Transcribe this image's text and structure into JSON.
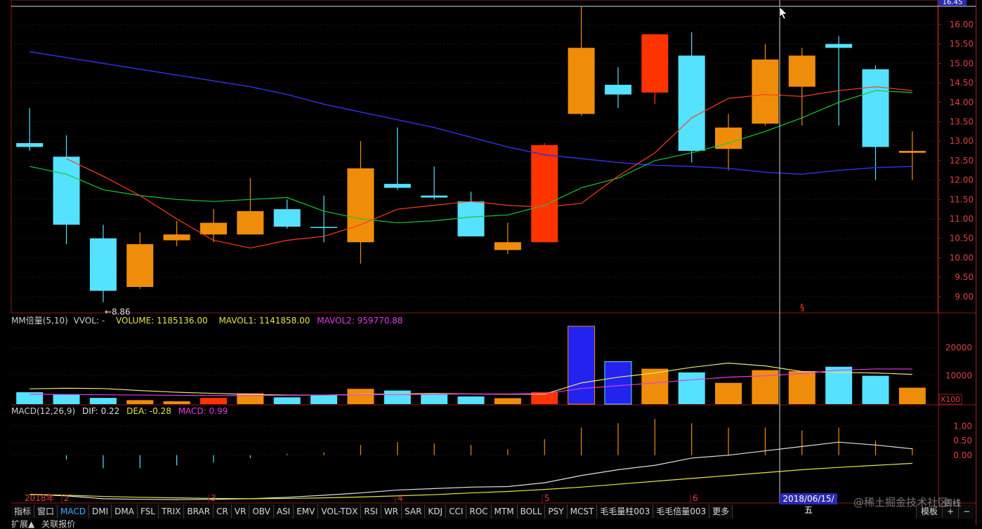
{
  "colors": {
    "up": "#ff3300",
    "up_hollow": "#ef8d0a",
    "down": "#54e2ff",
    "axis": "#8b1a1a",
    "grid": "#5a0f0f",
    "ma5": "#ff3b1f",
    "ma10": "#16c936",
    "ma60": "#2f2fe0",
    "vol_ma1": "#e6e66b",
    "vol_ma2": "#e33ae3",
    "dif": "#e0e0e0",
    "dea": "#e6e640",
    "blue_bar": "#2323f0"
  },
  "header": {
    "price_badge": "16.45",
    "low_marker": "8.86",
    "cursor_date": "2018/06/15/五",
    "flag": "§"
  },
  "volume_panel": {
    "indicator": "MM倍量(5,10)",
    "vvol": "VVOL: -",
    "volume": "VOLUME: 1185136.00",
    "mavol1": "MAVOL1: 1141858.00",
    "mavol2": "MAVOL2: 959770.88",
    "unit": "X100"
  },
  "macd_panel": {
    "indicator": "MACD(12,26,9)",
    "dif": "DIF: 0.22",
    "dea": "DEA: -0.28",
    "macd": "MACD: 0.99"
  },
  "x_axis": {
    "year": "2018年",
    "months": [
      "2",
      "3",
      "4",
      "5",
      "6"
    ]
  },
  "tabs": [
    "指标",
    "窗口",
    "MACD",
    "DMI",
    "DMA",
    "FSL",
    "TRIX",
    "BRAR",
    "CR",
    "VR",
    "OBV",
    "ASI",
    "EMV",
    "VOL-TDX",
    "RSI",
    "WR",
    "SAR",
    "KDJ",
    "CCI",
    "ROC",
    "MTM",
    "BOLL",
    "PSY",
    "MCST",
    "毛毛量柱003",
    "毛毛倍量003",
    "更多"
  ],
  "active_tab": "MACD",
  "right_buttons": [
    "模板",
    "+",
    "−"
  ],
  "bottom_bar": [
    "扩展▲",
    "关联报价"
  ],
  "watermark": "@稀土掘金技术社区",
  "watermark_tail": "周线",
  "chart_data": [
    {
      "type": "candlestick",
      "period": "weekly",
      "y_axis_ticks": [
        "16.00",
        "15.50",
        "15.00",
        "14.50",
        "14.00",
        "13.50",
        "13.00",
        "12.50",
        "12.00",
        "11.50",
        "11.00",
        "10.50",
        "10.00",
        "9.50",
        "9.00"
      ],
      "ylim": [
        8.6,
        16.45
      ],
      "candles": [
        {
          "open": 12.95,
          "high": 13.85,
          "low": 12.75,
          "close": 12.85,
          "dir": "down"
        },
        {
          "open": 12.6,
          "high": 13.15,
          "low": 10.35,
          "close": 10.85,
          "dir": "down"
        },
        {
          "open": 10.5,
          "high": 10.85,
          "low": 8.86,
          "close": 9.15,
          "dir": "down"
        },
        {
          "open": 9.25,
          "high": 10.65,
          "low": 9.2,
          "close": 10.35,
          "dir": "up"
        },
        {
          "open": 10.45,
          "high": 10.95,
          "low": 10.3,
          "close": 10.6,
          "dir": "up"
        },
        {
          "open": 10.6,
          "high": 11.25,
          "low": 10.4,
          "close": 10.9,
          "dir": "up"
        },
        {
          "open": 10.6,
          "high": 12.05,
          "low": 10.6,
          "close": 11.2,
          "dir": "up"
        },
        {
          "open": 11.25,
          "high": 11.5,
          "low": 10.75,
          "close": 10.8,
          "dir": "down"
        },
        {
          "open": 10.78,
          "high": 11.6,
          "low": 10.4,
          "close": 10.78,
          "dir": "doji"
        },
        {
          "open": 10.4,
          "high": 13.0,
          "low": 9.85,
          "close": 12.3,
          "dir": "up"
        },
        {
          "open": 11.9,
          "high": 13.35,
          "low": 11.75,
          "close": 11.8,
          "dir": "down"
        },
        {
          "open": 11.6,
          "high": 12.35,
          "low": 11.5,
          "close": 11.55,
          "dir": "down"
        },
        {
          "open": 11.45,
          "high": 11.7,
          "low": 10.6,
          "close": 10.55,
          "dir": "down"
        },
        {
          "open": 10.2,
          "high": 10.9,
          "low": 10.1,
          "close": 10.4,
          "dir": "up"
        },
        {
          "open": 10.4,
          "high": 12.95,
          "low": 10.4,
          "close": 12.9,
          "dir": "up_solid"
        },
        {
          "open": 13.7,
          "high": 16.45,
          "low": 13.65,
          "close": 15.4,
          "dir": "up"
        },
        {
          "open": 14.45,
          "high": 14.9,
          "low": 13.85,
          "close": 14.2,
          "dir": "down"
        },
        {
          "open": 14.25,
          "high": 15.75,
          "low": 13.95,
          "close": 15.75,
          "dir": "up_solid"
        },
        {
          "open": 15.2,
          "high": 15.8,
          "low": 12.45,
          "close": 12.75,
          "dir": "down"
        },
        {
          "open": 12.8,
          "high": 13.7,
          "low": 12.25,
          "close": 13.35,
          "dir": "up"
        },
        {
          "open": 13.45,
          "high": 15.5,
          "low": 13.4,
          "close": 15.1,
          "dir": "up"
        },
        {
          "open": 14.4,
          "high": 15.4,
          "low": 13.4,
          "close": 15.2,
          "dir": "up"
        },
        {
          "open": 15.5,
          "high": 15.7,
          "low": 13.4,
          "close": 15.4,
          "dir": "down"
        },
        {
          "open": 14.85,
          "high": 14.95,
          "low": 12.0,
          "close": 12.85,
          "dir": "down"
        },
        {
          "open": 12.7,
          "high": 13.25,
          "low": 12.0,
          "close": 12.75,
          "dir": "up"
        }
      ],
      "ma_short": [
        null,
        12.55,
        12.1,
        11.6,
        11.0,
        10.45,
        10.25,
        10.45,
        10.55,
        10.85,
        11.25,
        11.35,
        11.45,
        11.35,
        11.3,
        11.4,
        12.1,
        12.7,
        13.6,
        14.1,
        14.2,
        14.15,
        14.3,
        14.4,
        14.3
      ],
      "ma_mid": [
        12.35,
        12.15,
        11.75,
        11.6,
        11.5,
        11.45,
        11.5,
        11.55,
        11.2,
        11.0,
        10.9,
        10.95,
        11.05,
        11.1,
        11.35,
        11.8,
        12.05,
        12.5,
        12.7,
        12.95,
        13.25,
        13.6,
        14.0,
        14.3,
        14.25
      ],
      "ma_long": [
        15.3,
        15.15,
        15.0,
        14.85,
        14.7,
        14.55,
        14.4,
        14.2,
        13.95,
        13.75,
        13.55,
        13.35,
        13.1,
        12.85,
        12.65,
        12.55,
        12.45,
        12.38,
        12.35,
        12.3,
        12.2,
        12.15,
        12.25,
        12.32,
        12.35
      ]
    },
    {
      "type": "bar",
      "title": "MM倍量(5,10)",
      "y_axis_ticks": [
        "20000",
        "10000"
      ],
      "ylim": [
        0,
        28000
      ],
      "values": [
        4200,
        3500,
        2200,
        1400,
        1000,
        2200,
        3800,
        2400,
        3300,
        5400,
        4800,
        3700,
        2700,
        2100,
        4200,
        27500,
        15000,
        12500,
        11200,
        7500,
        12000,
        11600,
        13200,
        10000,
        5800
      ],
      "colors": [
        "down",
        "down",
        "down",
        "up",
        "up",
        "up_solid",
        "up",
        "down",
        "down",
        "up",
        "down",
        "down",
        "down",
        "up",
        "up_solid",
        "blue",
        "blue",
        "up",
        "down",
        "up",
        "up",
        "up",
        "down",
        "down",
        "up"
      ],
      "mavol1": [
        5400,
        5600,
        5500,
        4800,
        4200,
        3800,
        3400,
        3200,
        3200,
        3400,
        3600,
        3800,
        3600,
        3500,
        3500,
        7500,
        9500,
        11000,
        13000,
        14500,
        13500,
        11500,
        11200,
        11000,
        10500
      ],
      "mavol2": [
        3500,
        3400,
        3300,
        3200,
        3100,
        3000,
        3000,
        3100,
        3200,
        3300,
        3400,
        3500,
        3600,
        3600,
        3700,
        5500,
        6500,
        7500,
        8600,
        9500,
        10000,
        10800,
        12000,
        12400,
        12400
      ]
    },
    {
      "type": "macd",
      "title": "MACD(12,26,9)",
      "y_axis_ticks": [
        "1.00",
        "0.50",
        "0.00"
      ],
      "ylim": [
        -1.6,
        1.3
      ],
      "hist": [
        0.0,
        -0.15,
        -0.45,
        -0.45,
        -0.35,
        -0.25,
        -0.1,
        0.05,
        0.1,
        0.35,
        0.45,
        0.4,
        0.35,
        0.2,
        0.55,
        0.95,
        1.1,
        1.25,
        1.1,
        0.95,
        0.95,
        0.85,
        0.95,
        0.5,
        0.25
      ],
      "dif": [
        -1.35,
        -1.4,
        -1.5,
        -1.52,
        -1.53,
        -1.52,
        -1.5,
        -1.45,
        -1.38,
        -1.3,
        -1.2,
        -1.15,
        -1.1,
        -1.08,
        -0.95,
        -0.7,
        -0.5,
        -0.35,
        -0.1,
        0.0,
        0.15,
        0.3,
        0.45,
        0.35,
        0.22
      ],
      "dea": [
        -1.35,
        -1.38,
        -1.42,
        -1.45,
        -1.47,
        -1.49,
        -1.5,
        -1.49,
        -1.47,
        -1.44,
        -1.4,
        -1.36,
        -1.3,
        -1.25,
        -1.18,
        -1.1,
        -1.0,
        -0.9,
        -0.8,
        -0.7,
        -0.6,
        -0.5,
        -0.42,
        -0.35,
        -0.28
      ]
    }
  ]
}
